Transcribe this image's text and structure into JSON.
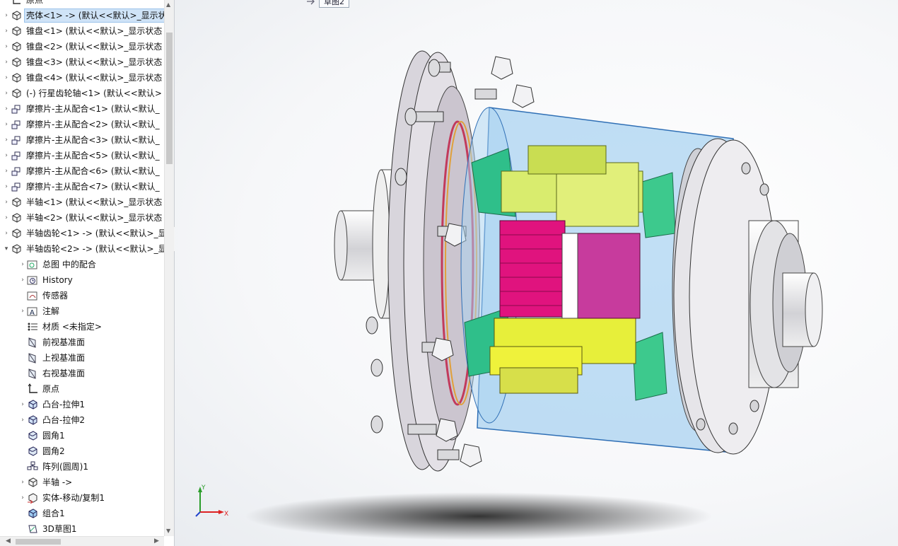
{
  "feature_tree": {
    "top_partial_label": "原点",
    "items": [
      {
        "label": "壳体<1> -> (默认<<默认>_显示状态",
        "selected": true
      },
      {
        "label": "锥盘<1> (默认<<默认>_显示状态"
      },
      {
        "label": "锥盘<2> (默认<<默认>_显示状态"
      },
      {
        "label": "锥盘<3> (默认<<默认>_显示状态"
      },
      {
        "label": "锥盘<4> (默认<<默认>_显示状态"
      },
      {
        "label": "(-) 行星齿轮轴<1> (默认<<默认>"
      },
      {
        "label": "摩擦片-主从配合<1> (默认<默认_"
      },
      {
        "label": "摩擦片-主从配合<2> (默认<默认_"
      },
      {
        "label": "摩擦片-主从配合<3> (默认<默认_"
      },
      {
        "label": "摩擦片-主从配合<5> (默认<默认_"
      },
      {
        "label": "摩擦片-主从配合<6> (默认<默认_"
      },
      {
        "label": "摩擦片-主从配合<7> (默认<默认_"
      },
      {
        "label": "半轴<1> (默认<<默认>_显示状态"
      },
      {
        "label": "半轴<2> (默认<<默认>_显示状态"
      },
      {
        "label": "半轴齿轮<1> -> (默认<<默认>_显"
      },
      {
        "label": "半轴齿轮<2> -> (默认<<默认>_显"
      }
    ],
    "children": [
      {
        "label": "总图 中的配合",
        "icon": "mates-icon"
      },
      {
        "label": "History",
        "icon": "history-icon"
      },
      {
        "label": "传感器",
        "icon": "sensor-icon"
      },
      {
        "label": "注解",
        "icon": "annotation-icon"
      },
      {
        "label": "材质 <未指定>",
        "icon": "material-icon"
      },
      {
        "label": "前视基准面",
        "icon": "plane-icon"
      },
      {
        "label": "上视基准面",
        "icon": "plane-icon"
      },
      {
        "label": "右视基准面",
        "icon": "plane-icon"
      },
      {
        "label": "原点",
        "icon": "origin-icon"
      },
      {
        "label": "凸台-拉伸1",
        "icon": "extrude-icon"
      },
      {
        "label": "凸台-拉伸2",
        "icon": "extrude-icon"
      },
      {
        "label": "圆角1",
        "icon": "fillet-icon"
      },
      {
        "label": "圆角2",
        "icon": "fillet-icon"
      },
      {
        "label": "阵列(圆周)1",
        "icon": "pattern-icon"
      },
      {
        "label": "半轴 ->",
        "icon": "part-icon"
      },
      {
        "label": "实体-移动/复制1",
        "icon": "move-copy-icon"
      },
      {
        "label": "组合1",
        "icon": "combine-icon"
      },
      {
        "label": "3D草图1",
        "icon": "sketch3d-icon"
      }
    ]
  },
  "viewport": {
    "sketch_tag": "草图2",
    "triad": {
      "x_label": "X",
      "y_label": "Y"
    }
  },
  "colors": {
    "housing_glass": "#8ec4ec",
    "gear_yellow": "#e7ef3a",
    "gear_lime": "#d9ec6e",
    "gear_magenta": "#e0137e",
    "cone_green": "#2fbf8a",
    "metal": "#e6e6e8",
    "flange": "#d9d6de"
  }
}
